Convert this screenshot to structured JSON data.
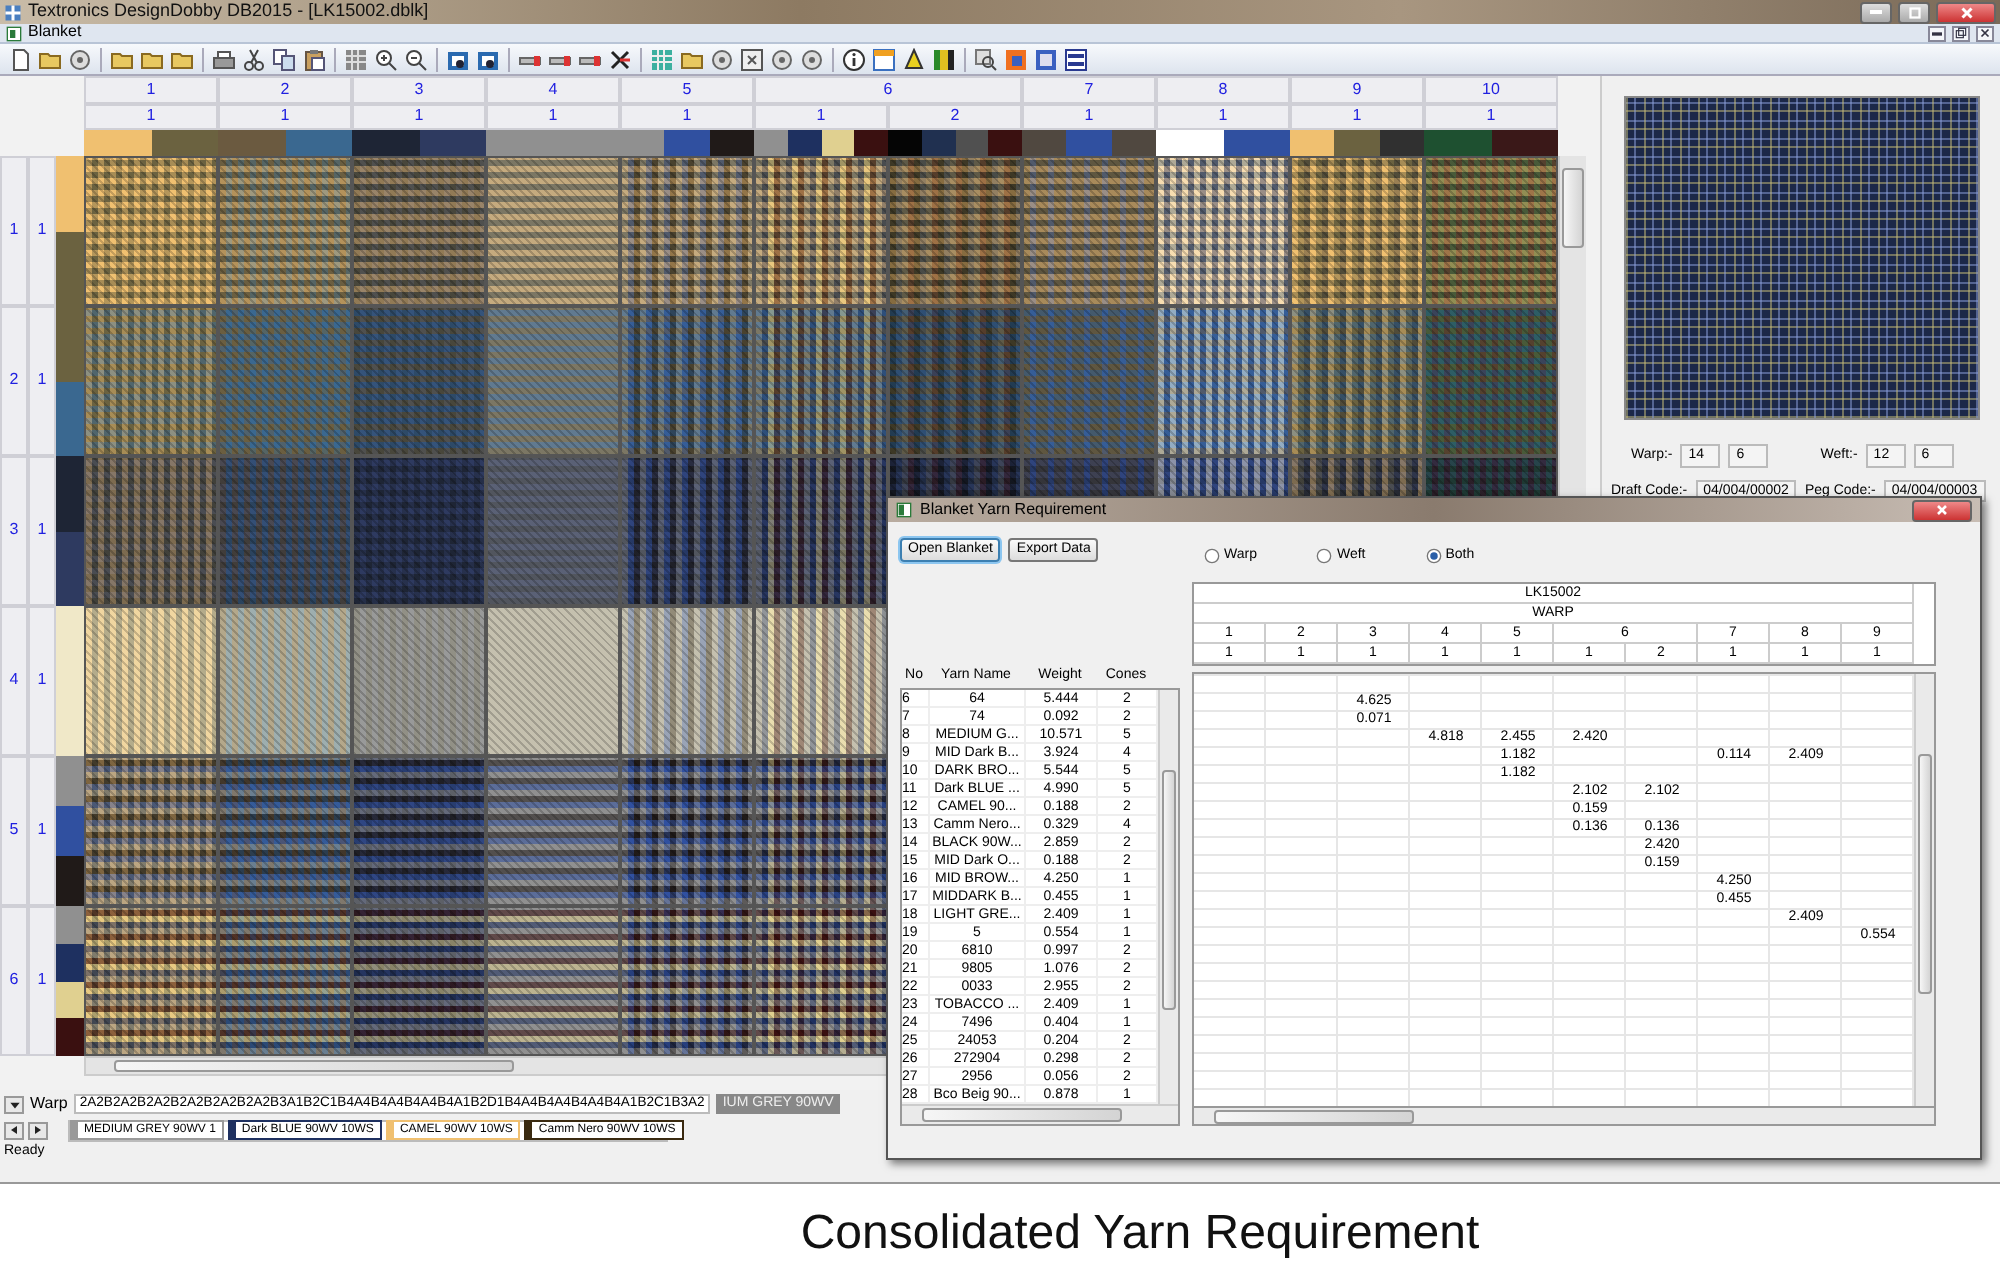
{
  "window": {
    "title": "Textronics DesignDobby DB2015 - [LK15002.dblk]"
  },
  "document_tab": {
    "label": "Blanket"
  },
  "blanket": {
    "columns": [
      {
        "label": "1",
        "parts": [
          {
            "label": "1",
            "swatches": [
              {
                "color": "#f0c070"
              },
              {
                "color": "#6b6240"
              }
            ]
          }
        ]
      },
      {
        "label": "2",
        "parts": [
          {
            "label": "1",
            "swatches": [
              {
                "color": "#6b5a40"
              },
              {
                "color": "#3a6890"
              }
            ]
          }
        ]
      },
      {
        "label": "3",
        "parts": [
          {
            "label": "1",
            "swatches": [
              {
                "color": "#1e2535"
              },
              {
                "color": "#2e3a60"
              }
            ]
          }
        ]
      },
      {
        "label": "4",
        "parts": [
          {
            "label": "1",
            "swatches": [
              {
                "color": "#909090"
              }
            ]
          }
        ]
      },
      {
        "label": "5",
        "parts": [
          {
            "label": "1",
            "swatches": [
              {
                "color": "#909090"
              },
              {
                "color": "#3050a0"
              },
              {
                "color": "#201a18"
              }
            ]
          }
        ]
      },
      {
        "label": "6",
        "parts": [
          {
            "label": "1",
            "swatches": [
              {
                "color": "#909090"
              },
              {
                "color": "#1e3060"
              },
              {
                "color": "#e0d090"
              },
              {
                "color": "#3a1010"
              }
            ]
          },
          {
            "label": "2",
            "swatches": [
              {
                "color": "#050505"
              },
              {
                "color": "#203050"
              },
              {
                "color": "#505050"
              },
              {
                "color": "#3a1010"
              }
            ]
          }
        ]
      },
      {
        "label": "7",
        "parts": [
          {
            "label": "1",
            "swatches": [
              {
                "color": "#504840"
              },
              {
                "color": "#3050a0"
              },
              {
                "color": "#504840"
              }
            ]
          }
        ]
      },
      {
        "label": "8",
        "parts": [
          {
            "label": "1",
            "swatches": [
              {
                "color": "#ffffff"
              },
              {
                "color": "#3050a0"
              }
            ]
          }
        ]
      },
      {
        "label": "9",
        "parts": [
          {
            "label": "1",
            "swatches": [
              {
                "color": "#f0c070"
              },
              {
                "color": "#6b6240"
              },
              {
                "color": "#303030"
              }
            ]
          }
        ]
      },
      {
        "label": "10",
        "parts": [
          {
            "label": "1",
            "swatches": [
              {
                "color": "#1e5030"
              },
              {
                "color": "#3a1818"
              }
            ]
          }
        ]
      }
    ],
    "rows": [
      {
        "label": "1",
        "parts": [
          {
            "label": "1",
            "swatches": [
              {
                "color": "#f0c070"
              },
              {
                "color": "#6b6240"
              }
            ]
          }
        ]
      },
      {
        "label": "2",
        "parts": [
          {
            "label": "1",
            "swatches": [
              {
                "color": "#6b6240"
              },
              {
                "color": "#3a6890"
              }
            ]
          }
        ]
      },
      {
        "label": "3",
        "parts": [
          {
            "label": "1",
            "swatches": [
              {
                "color": "#1e2535"
              },
              {
                "color": "#2e3a60"
              }
            ]
          }
        ]
      },
      {
        "label": "4",
        "parts": [
          {
            "label": "1",
            "swatches": [
              {
                "color": "#f0e8c8"
              }
            ]
          }
        ]
      },
      {
        "label": "5",
        "parts": [
          {
            "label": "1",
            "swatches": [
              {
                "color": "#909090"
              },
              {
                "color": "#3050a0"
              },
              {
                "color": "#201a18"
              }
            ]
          }
        ]
      },
      {
        "label": "6",
        "parts": [
          {
            "label": "1",
            "swatches": [
              {
                "color": "#909090"
              },
              {
                "color": "#1e3060"
              },
              {
                "color": "#e0d090"
              },
              {
                "color": "#3a1010"
              }
            ]
          }
        ]
      }
    ]
  },
  "preview": {
    "warp_label": "Warp:-",
    "warp_values": [
      "14",
      "6"
    ],
    "weft_label": "Weft:-",
    "weft_values": [
      "12",
      "6"
    ],
    "draft_code_label": "Draft Code:-",
    "draft_code": "04/004/00002",
    "peg_code_label": "Peg Code:-",
    "peg_code": "04/004/00003"
  },
  "sequence": {
    "label": "Warp",
    "code": "2A2B2A2B2A2B2A2B2A2B2A2B3A1B2C1B4A4B4A4B4A4B4A1B2D1B4A4B4A4B4A4B4A1B2C1B3A2",
    "yarn": "IUM GREY 90WV"
  },
  "yarn_chips": [
    {
      "label": "MEDIUM GREY 90WV 1",
      "color": "#9a9a9a"
    },
    {
      "label": "Dark BLUE 90WV 10WS",
      "color": "#1e3060"
    },
    {
      "label": "CAMEL  90WV 10WS",
      "color": "#f0c070"
    },
    {
      "label": "Camm Nero 90WV 10WS",
      "color": "#3a2a10"
    }
  ],
  "status_bar": "Ready",
  "dialog": {
    "title": "Blanket Yarn Requirement",
    "buttons": [
      "Open Blanket",
      "Export Data"
    ],
    "options": [
      {
        "label": "Warp",
        "selected": false
      },
      {
        "label": "Weft",
        "selected": false
      },
      {
        "label": "Both",
        "selected": true
      }
    ],
    "yarn_columns": [
      "No",
      "Yarn Name",
      "Weight",
      "Cones"
    ],
    "yarns": [
      {
        "no": "6",
        "name": "64",
        "weight": "5.444",
        "cones": "2",
        "amounts": {
          "c3_1": "4.625"
        }
      },
      {
        "no": "7",
        "name": "74",
        "weight": "0.092",
        "cones": "2",
        "amounts": {
          "c3_1": "0.071"
        }
      },
      {
        "no": "8",
        "name": "MEDIUM G...",
        "weight": "10.571",
        "cones": "5",
        "amounts": {
          "c4_1": "4.818",
          "c5_1": "2.455",
          "c6_1": "2.420"
        }
      },
      {
        "no": "9",
        "name": "MID Dark B...",
        "weight": "3.924",
        "cones": "4",
        "amounts": {
          "c5_1": "1.182",
          "c7_1": "0.114",
          "c8_1": "2.409"
        }
      },
      {
        "no": "10",
        "name": "DARK BRO...",
        "weight": "5.544",
        "cones": "5",
        "amounts": {
          "c5_1": "1.182"
        }
      },
      {
        "no": "11",
        "name": "Dark BLUE ...",
        "weight": "4.990",
        "cones": "5",
        "amounts": {
          "c6_1": "2.102",
          "c6_2": "2.102"
        }
      },
      {
        "no": "12",
        "name": "CAMEL  90...",
        "weight": "0.188",
        "cones": "2",
        "amounts": {
          "c6_1": "0.159"
        }
      },
      {
        "no": "13",
        "name": "Camm Nero...",
        "weight": "0.329",
        "cones": "4",
        "amounts": {
          "c6_1": "0.136",
          "c6_2": "0.136"
        }
      },
      {
        "no": "14",
        "name": "BLACK 90W...",
        "weight": "2.859",
        "cones": "2",
        "amounts": {
          "c6_2": "2.420"
        }
      },
      {
        "no": "15",
        "name": "MID Dark O...",
        "weight": "0.188",
        "cones": "2",
        "amounts": {
          "c6_2": "0.159"
        }
      },
      {
        "no": "16",
        "name": "MID BROW...",
        "weight": "4.250",
        "cones": "1",
        "amounts": {
          "c7_1": "4.250"
        }
      },
      {
        "no": "17",
        "name": "MIDDARK B...",
        "weight": "0.455",
        "cones": "1",
        "amounts": {
          "c7_1": "0.455"
        }
      },
      {
        "no": "18",
        "name": "LIGHT GRE...",
        "weight": "2.409",
        "cones": "1",
        "amounts": {
          "c8_1": "2.409"
        }
      },
      {
        "no": "19",
        "name": "5",
        "weight": "0.554",
        "cones": "1",
        "amounts": {
          "c9_1": "0.554"
        }
      },
      {
        "no": "20",
        "name": "6810",
        "weight": "0.997",
        "cones": "2"
      },
      {
        "no": "21",
        "name": "9805",
        "weight": "1.076",
        "cones": "2"
      },
      {
        "no": "22",
        "name": "0033",
        "weight": "2.955",
        "cones": "2"
      },
      {
        "no": "23",
        "name": "TOBACCO ...",
        "weight": "2.409",
        "cones": "1"
      },
      {
        "no": "24",
        "name": "7496",
        "weight": "0.404",
        "cones": "1"
      },
      {
        "no": "25",
        "name": "24053",
        "weight": "0.204",
        "cones": "2"
      },
      {
        "no": "26",
        "name": "272904",
        "weight": "0.298",
        "cones": "2"
      },
      {
        "no": "27",
        "name": "2956",
        "weight": "0.056",
        "cones": "2"
      },
      {
        "no": "28",
        "name": "Bco Beig 90...",
        "weight": "0.878",
        "cones": "1"
      }
    ],
    "matrix_title": "LK15002",
    "matrix_subtitle": "WARP",
    "matrix_columns": [
      {
        "label": "1",
        "parts": [
          "1"
        ]
      },
      {
        "label": "2",
        "parts": [
          "1"
        ]
      },
      {
        "label": "3",
        "parts": [
          "1"
        ]
      },
      {
        "label": "4",
        "parts": [
          "1"
        ]
      },
      {
        "label": "5",
        "parts": [
          "1"
        ]
      },
      {
        "label": "6",
        "parts": [
          "1",
          "2"
        ]
      },
      {
        "label": "7",
        "parts": [
          "1"
        ]
      },
      {
        "label": "8",
        "parts": [
          "1"
        ]
      },
      {
        "label": "9",
        "parts": [
          "1"
        ]
      }
    ]
  },
  "caption": "Consolidated Yarn Requirement"
}
